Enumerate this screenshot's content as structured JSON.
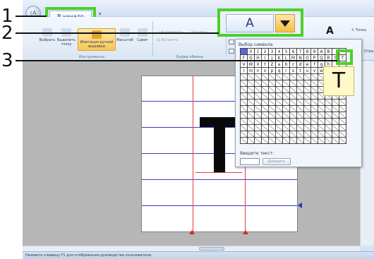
{
  "title_bar": {
    "app_button_label": "(A"
  },
  "tabs": {
    "home_label": "В начало"
  },
  "callouts": {
    "one": "1",
    "two": "2",
    "three": "3"
  },
  "ribbon": {
    "tools": {
      "select": "Выбрать",
      "select_point": "Выделить точку",
      "manual_embroidery": "Имитация ручной вышивки",
      "scale": "Масштаб",
      "shift": "Сдвиг",
      "group_label": "Инструменты"
    },
    "clipboard": {
      "copy": "Копировать",
      "delete": "Удалить",
      "paste": "Вставить",
      "group_label": "Буфер обмена"
    },
    "font": {
      "selected_value": "A",
      "big_glyph": "A"
    },
    "right": {
      "point": "Точка",
      "extra": "Отра"
    }
  },
  "symbol_popup": {
    "title": "Выбор символа",
    "rows": [
      [
        "",
        "0",
        "1",
        "2",
        "3",
        "4",
        "5",
        "6",
        "7",
        "8",
        "9",
        "A",
        "B",
        "",
        ""
      ],
      [
        "F",
        "G",
        "H",
        "I",
        "J",
        "K",
        "L",
        "M",
        "N",
        "O",
        "P",
        "Q",
        "R",
        "S",
        "T"
      ],
      [
        "V",
        "W",
        "X",
        "Y",
        "Z",
        "a",
        "b",
        "c",
        "d",
        "e",
        "f",
        "g",
        "h",
        "",
        ""
      ],
      [
        "l",
        "m",
        "n",
        "o",
        "p",
        "q",
        "r",
        "s",
        "t",
        "u",
        "v",
        "w",
        "x",
        "y",
        "z"
      ]
    ],
    "empty_rows": 11,
    "selected_char": "T",
    "magnified_char": "T",
    "enter_text_label": "Введите текст:",
    "text_value": "",
    "add_button": "Добавить"
  },
  "canvas": {
    "letter": "T"
  },
  "statusbar": {
    "text": "Нажмите клавишу F1 для отображения руководства пользователя."
  },
  "colors": {
    "callout_green": "#4cd02a",
    "grid_blue": "#3a3fbf",
    "grid_red": "#e04040",
    "selection_blue": "#5865d8"
  }
}
